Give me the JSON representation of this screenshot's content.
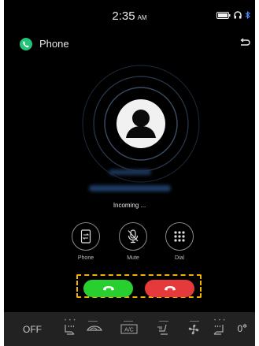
{
  "status_bar": {
    "time": "2:35",
    "ampm": "AM"
  },
  "app": {
    "title": "Phone"
  },
  "call": {
    "status": "Incoming ..."
  },
  "actions": [
    {
      "label": "Phone"
    },
    {
      "label": "Mute"
    },
    {
      "label": "Dial"
    }
  ],
  "climate": {
    "power": "OFF",
    "fan_level": "0"
  },
  "colors": {
    "answer": "#28d02f",
    "decline": "#e6393b",
    "highlight": "#f0b000",
    "app_icon": "#22c47a"
  }
}
